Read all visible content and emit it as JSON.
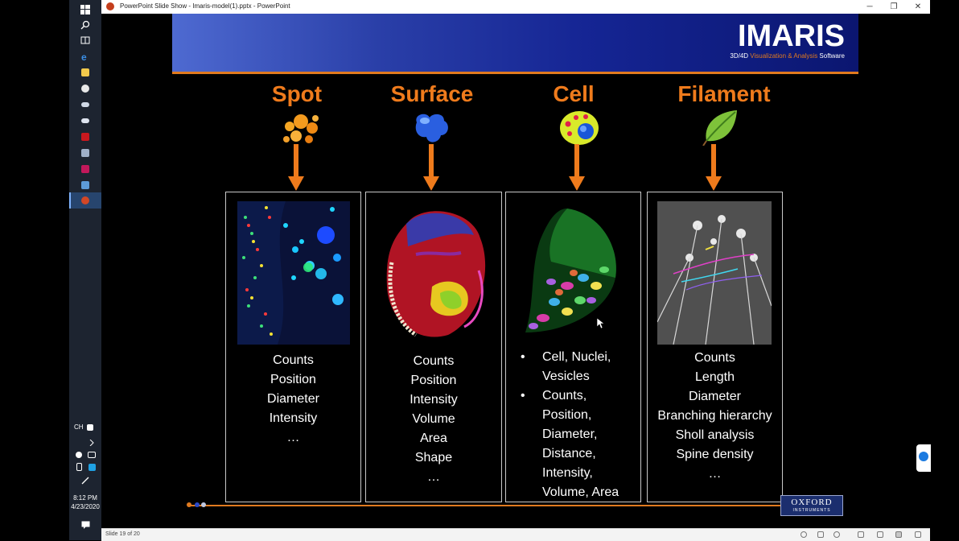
{
  "window": {
    "title": "PowerPoint Slide Show  -  Imaris-model(1).pptx - PowerPoint",
    "controls": {
      "minimize": "─",
      "restore": "❐",
      "close": "✕"
    }
  },
  "taskbar": {
    "icons": [
      "windows-start",
      "search",
      "task-view",
      "edge",
      "file-explorer",
      "app-red-circle",
      "app-cloud",
      "app-cloud-2",
      "filezilla",
      "app-folder",
      "app-red-square",
      "app-blue-window",
      "powerpoint"
    ],
    "language": "CH",
    "time": "8:12 PM",
    "date": "4/23/2020"
  },
  "statusbar": {
    "slide_info": "Slide 19 of 20"
  },
  "slide": {
    "logo": {
      "name": "IMARIS",
      "tagline_prefix": "3D/4D ",
      "tagline_accent": "Visualization & Analysis",
      "tagline_suffix": " Software"
    },
    "columns": [
      {
        "title": "Spot",
        "items": [
          "Counts",
          "Position",
          "Diameter",
          "Intensity",
          "…"
        ]
      },
      {
        "title": "Surface",
        "items": [
          "Counts",
          "Position",
          "Intensity",
          "Volume",
          "Area",
          "Shape",
          "…"
        ]
      },
      {
        "title": "Cell",
        "bullets": [
          [
            "Cell, Nuclei,",
            "Vesicles"
          ],
          [
            "Counts,",
            "Position,",
            "Diameter,",
            "Distance,",
            "Intensity,",
            "Volume, Area"
          ]
        ]
      },
      {
        "title": "Filament",
        "items": [
          "Counts",
          "Length",
          "Diameter",
          "Branching hierarchy",
          "Sholl analysis",
          "Spine density",
          "…"
        ]
      }
    ],
    "footer_logo": {
      "line1": "OXFORD",
      "line2": "INSTRUMENTS"
    }
  },
  "colors": {
    "accent_orange": "#ef7b1c",
    "banner_blue": "#152594",
    "panel_border": "#c8c8c8"
  }
}
